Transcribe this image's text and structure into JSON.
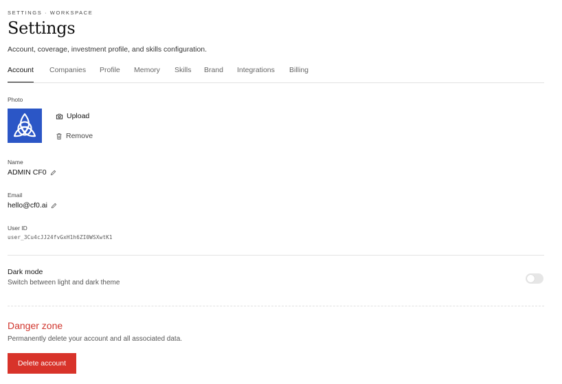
{
  "header": {
    "breadcrumb": "SETTINGS · WORKSPACE",
    "title": "Settings",
    "subtitle": "Account, coverage, investment profile, and skills configuration."
  },
  "tabs": [
    {
      "label": "Account",
      "active": true
    },
    {
      "label": "Companies",
      "active": false
    },
    {
      "label": "Profile",
      "active": false
    },
    {
      "label": "Memory",
      "active": false
    },
    {
      "label": "Skills",
      "active": false
    },
    {
      "label": "Brand",
      "active": false
    },
    {
      "label": "Integrations",
      "active": false
    },
    {
      "label": "Billing",
      "active": false
    }
  ],
  "account": {
    "photo_label": "Photo",
    "upload_label": "Upload",
    "remove_label": "Remove",
    "name_label": "Name",
    "name_value": "ADMIN CF0",
    "email_label": "Email",
    "email_value": "hello@cf0.ai",
    "user_id_label": "User ID",
    "user_id_value": "user_3Cu4cJJ24fvGxH1h6ZI0WSXwtK1"
  },
  "preferences": {
    "dark_mode_title": "Dark mode",
    "dark_mode_desc": "Switch between light and dark theme",
    "dark_mode_enabled": false
  },
  "danger": {
    "title": "Danger zone",
    "description": "Permanently delete your account and all associated data.",
    "button_label": "Delete account"
  },
  "colors": {
    "avatar_bg": "#2b56c6",
    "danger": "#d0342c",
    "danger_button": "#d8332a"
  },
  "icons": {
    "upload": "camera-icon",
    "remove": "trash-icon",
    "edit": "pencil-icon",
    "avatar_logo": "trinity-knot-icon"
  }
}
